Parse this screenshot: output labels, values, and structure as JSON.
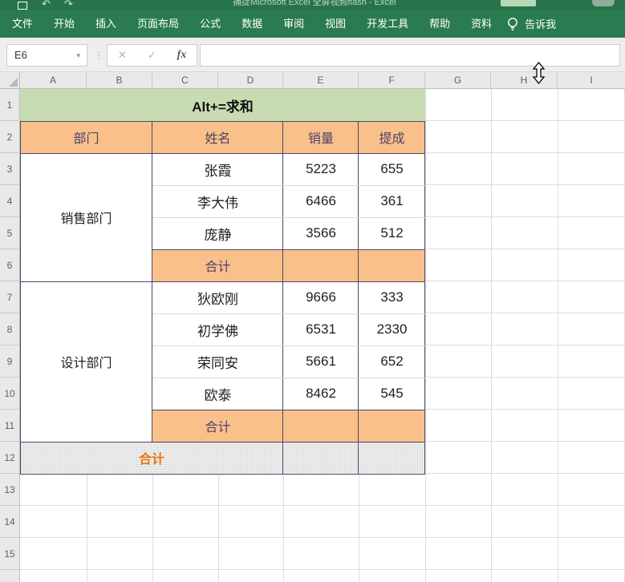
{
  "title_bar": {
    "partial_title": "捕捉Microsoft Excel 全屏视频flash - Excel",
    "undo_icon": "↶",
    "redo_icon": "↷"
  },
  "ribbon": {
    "tabs": [
      "文件",
      "开始",
      "插入",
      "页面布局",
      "公式",
      "数据",
      "审阅",
      "视图",
      "开发工具",
      "帮助",
      "资料"
    ],
    "tell_me_label": "告诉我"
  },
  "formula_bar": {
    "name_box_value": "E6",
    "name_box_caret": "▾",
    "handle_icon": "⋮",
    "cancel_icon": "✕",
    "confirm_icon": "✓",
    "fx_label": "fx",
    "formula_value": ""
  },
  "grid": {
    "column_headers": [
      "A",
      "B",
      "C",
      "D",
      "E",
      "F",
      "G",
      "H",
      "I"
    ],
    "row_headers": [
      "1",
      "2",
      "3",
      "4",
      "5",
      "6",
      "7",
      "8",
      "9",
      "10",
      "11",
      "12",
      "13",
      "14",
      "15"
    ],
    "banner": {
      "text": "Alt+=求和"
    },
    "table": {
      "headers": {
        "dept": "部门",
        "name": "姓名",
        "sales": "销量",
        "commission": "提成"
      },
      "groups": [
        {
          "dept": "销售部门",
          "rows": [
            {
              "name": "张霞",
              "sales": "5223",
              "commission": "655"
            },
            {
              "name": "李大伟",
              "sales": "6466",
              "commission": "361"
            },
            {
              "name": "庞静",
              "sales": "3566",
              "commission": "512"
            }
          ],
          "subtotal_label": "合计"
        },
        {
          "dept": "设计部门",
          "rows": [
            {
              "name": "狄欧刚",
              "sales": "9666",
              "commission": "333"
            },
            {
              "name": "初学佛",
              "sales": "6531",
              "commission": "2330"
            },
            {
              "name": "荣同安",
              "sales": "5661",
              "commission": "652"
            },
            {
              "name": "欧泰",
              "sales": "8462",
              "commission": "545"
            }
          ],
          "subtotal_label": "合计"
        }
      ],
      "grand_total_label": "合计"
    }
  },
  "colors": {
    "ribbon_green": "#2a7b4f",
    "banner_green": "#c8dcb2",
    "header_orange": "#f9c189",
    "purple_text": "#4d4069",
    "dark_border": "#4e4569",
    "grand_total_orange": "#e87410",
    "gridline": "#dcdcdc"
  }
}
